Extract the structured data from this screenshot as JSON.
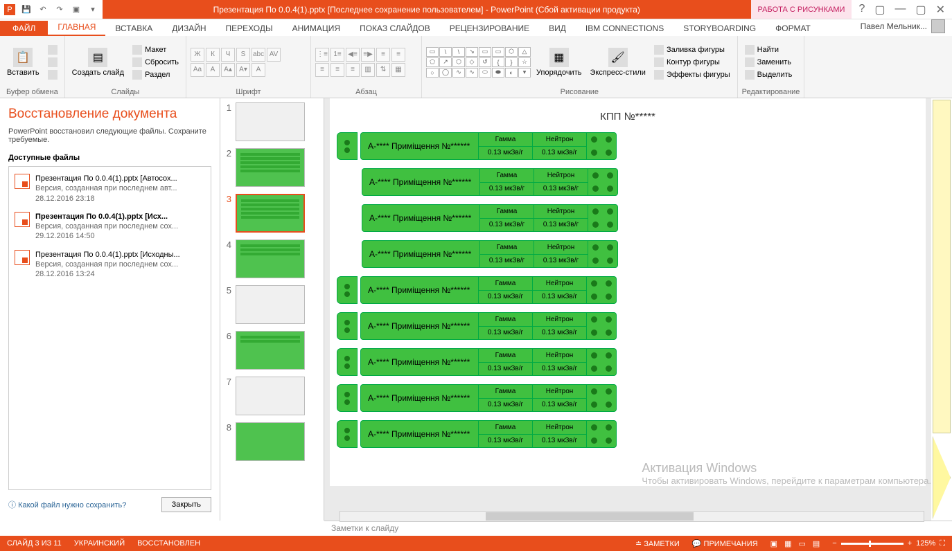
{
  "title": "Презентация По 0.0.4(1).pptx [Последнее сохранение пользователем] - PowerPoint (Сбой активации продукта)",
  "tools_tab": "РАБОТА С РИСУНКАМИ",
  "user": "Павел Мельник...",
  "tabs": {
    "file": "ФАЙЛ",
    "home": "ГЛАВНАЯ",
    "insert": "ВСТАВКА",
    "design": "ДИЗАЙН",
    "transitions": "ПЕРЕХОДЫ",
    "animation": "АНИМАЦИЯ",
    "slideshow": "ПОКАЗ СЛАЙДОВ",
    "review": "РЕЦЕНЗИРОВАНИЕ",
    "view": "ВИД",
    "ibm": "IBM CONNECTIONS",
    "story": "STORYBOARDING",
    "format": "ФОРМАТ"
  },
  "ribbon": {
    "paste": "Вставить",
    "clipboard": "Буфер обмена",
    "newslide": "Создать слайд",
    "layout": "Макет",
    "reset": "Сбросить",
    "section": "Раздел",
    "slides": "Слайды",
    "font": "Шрифт",
    "paragraph": "Абзац",
    "arrange": "Упорядочить",
    "express": "Экспресс-стили",
    "shapefill": "Заливка фигуры",
    "shapeoutline": "Контур фигуры",
    "shapeeffects": "Эффекты фигуры",
    "drawing": "Рисование",
    "find": "Найти",
    "replace": "Заменить",
    "select": "Выделить",
    "editing": "Редактирование"
  },
  "recovery": {
    "title": "Восстановление документа",
    "desc": "PowerPoint восстановил следующие файлы. Сохраните требуемые.",
    "available": "Доступные файлы",
    "files": [
      {
        "name": "Презентация По 0.0.4(1).pptx  [Автосох...",
        "ver": "Версия, созданная при последнем авт...",
        "date": "28.12.2016 23:18"
      },
      {
        "name": "Презентация По 0.0.4(1).pptx  [Исх...",
        "ver": "Версия, созданная при последнем сох...",
        "date": "29.12.2016 14:50"
      },
      {
        "name": "Презентация По 0.0.4(1).pptx  [Исходны...",
        "ver": "Версия, созданная при последнем сох...",
        "date": "28.12.2016 13:24"
      }
    ],
    "which": "Какой файл нужно сохранить?",
    "close": "Закрыть"
  },
  "slide": {
    "title": "КПП №*****",
    "room": "А-**** Приміщення №******",
    "gamma": "Гамма",
    "neutron": "Нейтрон",
    "val": "0.13 мкЗв/г"
  },
  "notes": "Заметки к слайду",
  "status": {
    "slide": "СЛАЙД 3 ИЗ 11",
    "lang": "УКРАИНСКИЙ",
    "restored": "ВОССТАНОВЛЕН",
    "notesbtn": "ЗАМЕТКИ",
    "comments": "ПРИМЕЧАНИЯ",
    "zoom": "125%"
  },
  "watermark": {
    "t1": "Активация Windows",
    "t2": "Чтобы активировать Windows, перейдите к параметрам компьютера."
  }
}
